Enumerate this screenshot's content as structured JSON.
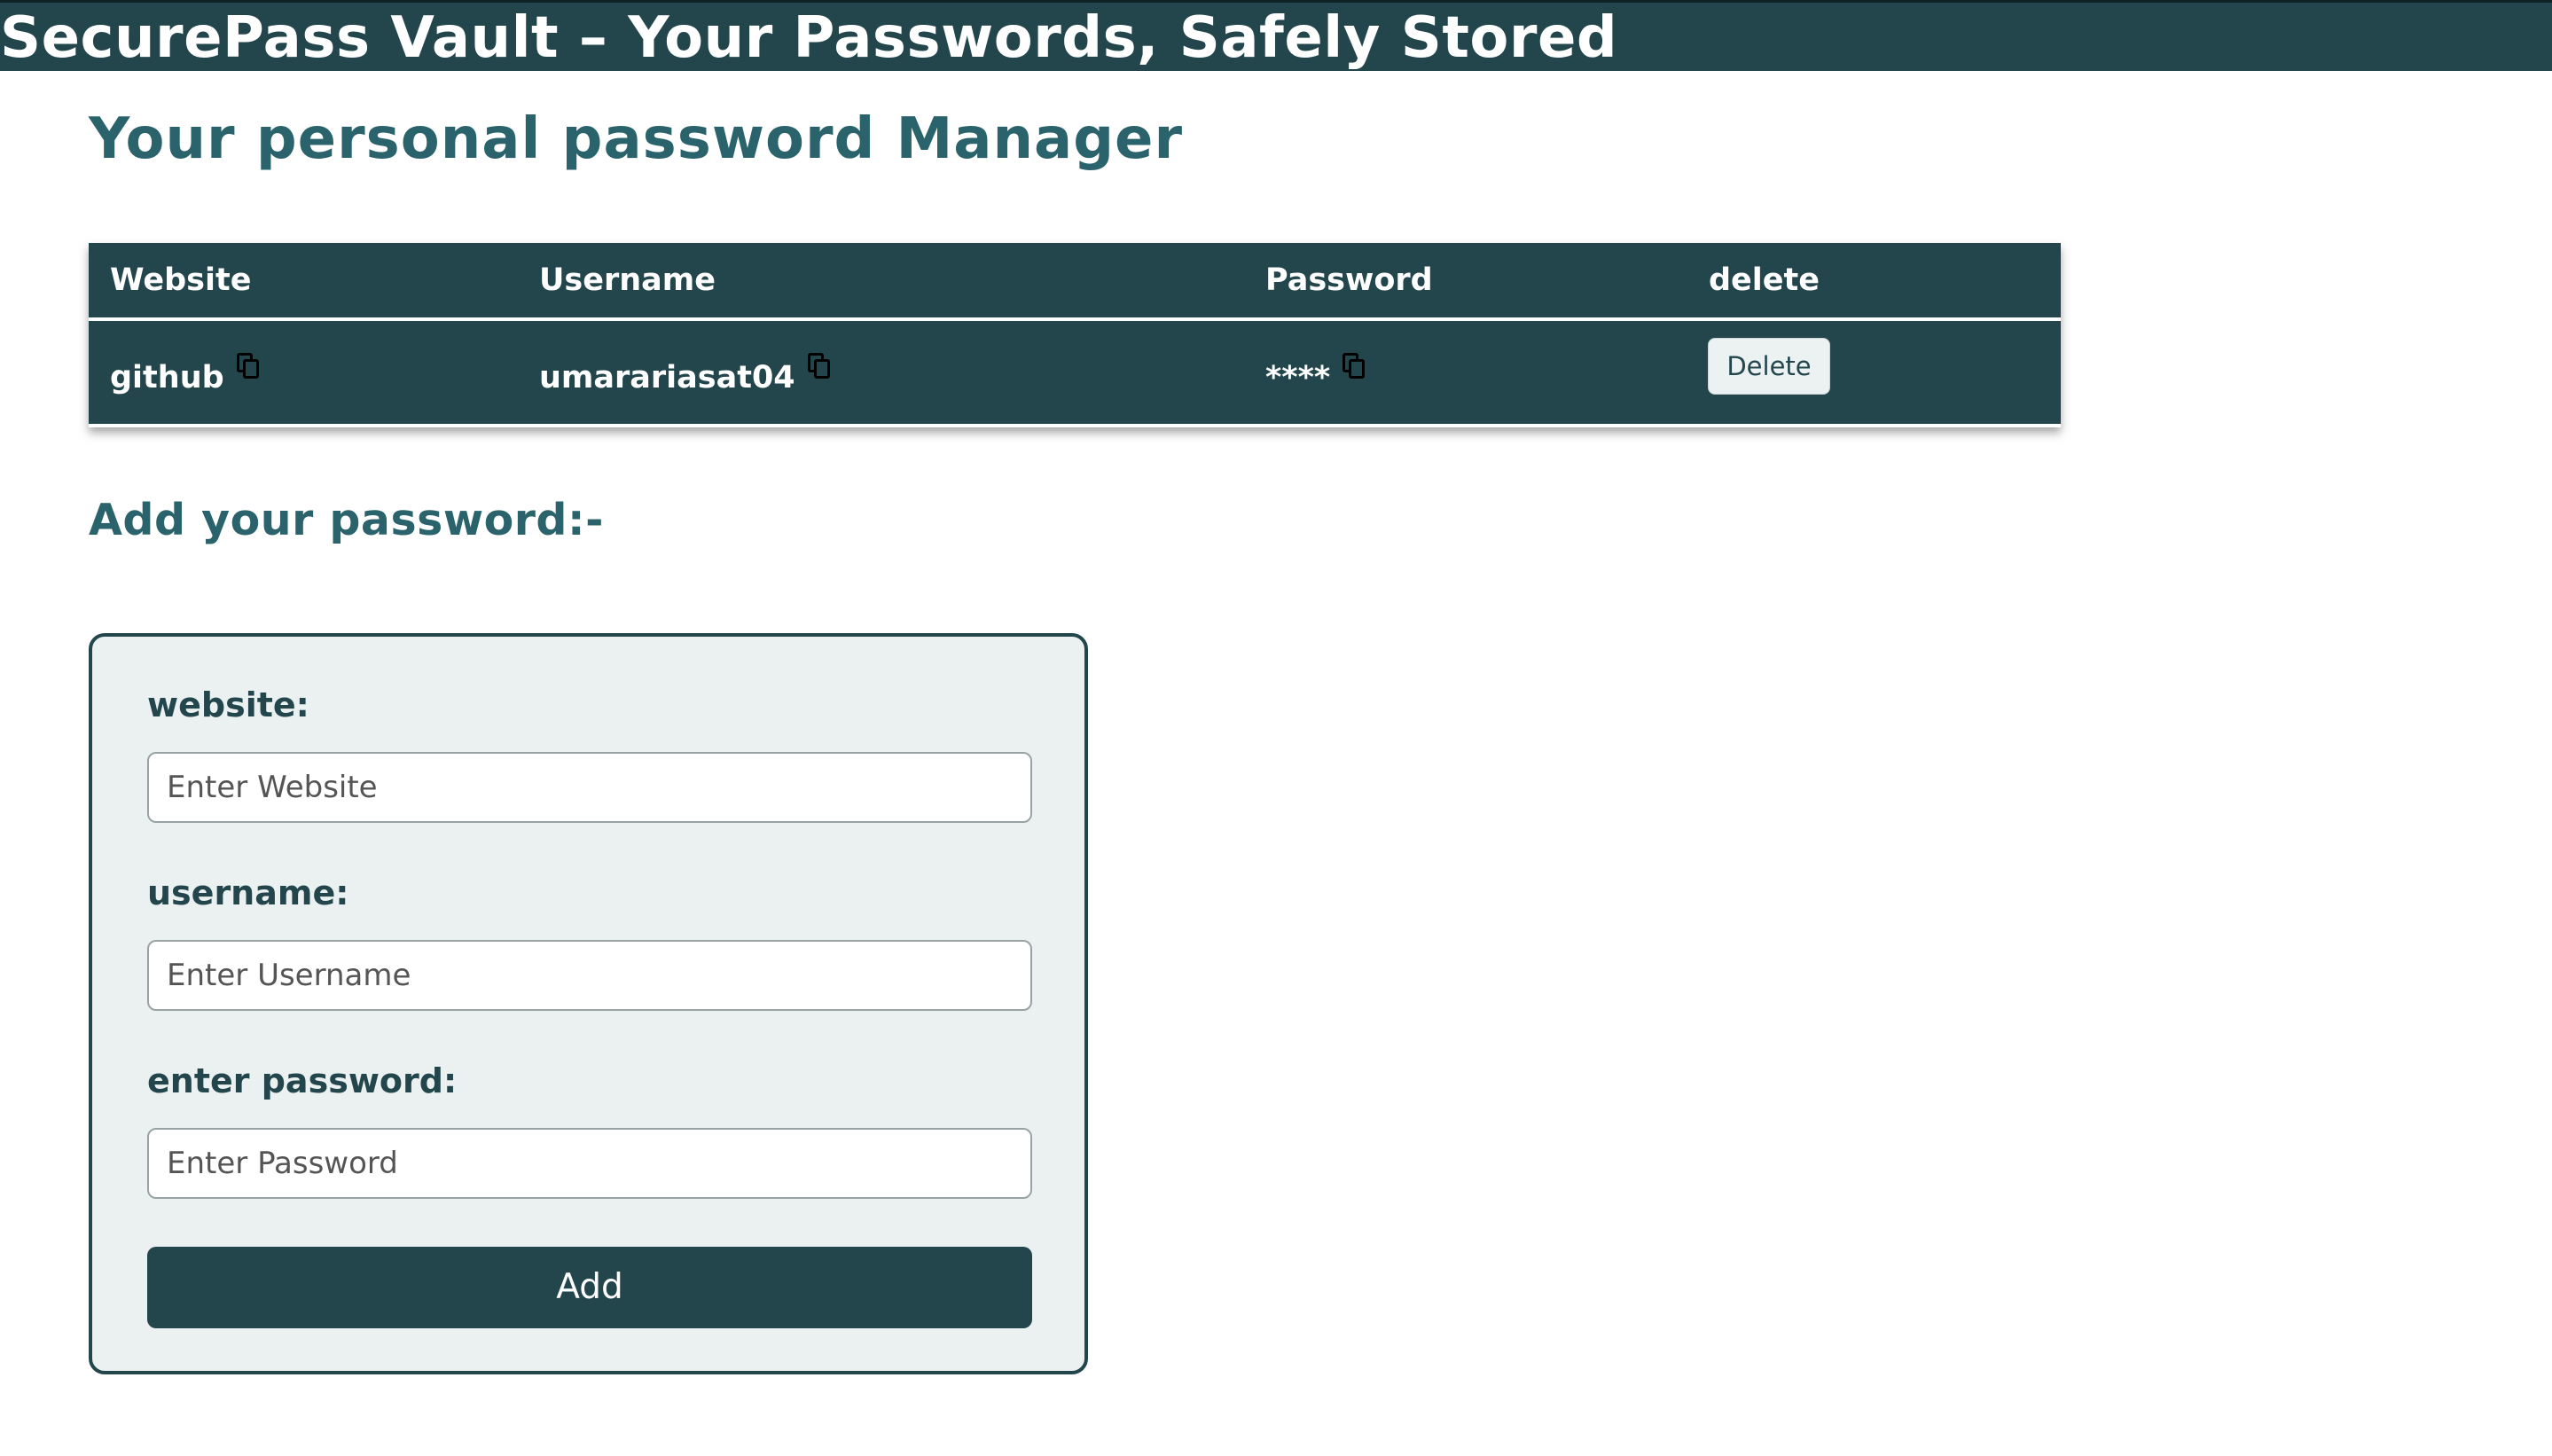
{
  "header": {
    "title": "SecurePass Vault – Your Passwords, Safely Stored"
  },
  "page": {
    "heading": "Your personal password Manager"
  },
  "table": {
    "columns": [
      "Website",
      "Username",
      "Password",
      "delete"
    ],
    "rows": [
      {
        "website": "github",
        "username": "umarariasat04",
        "password": "****",
        "delete_label": "Delete"
      }
    ]
  },
  "form": {
    "heading": "Add your password:-",
    "website_label": "website:",
    "website_placeholder": "Enter Website",
    "username_label": "username:",
    "username_placeholder": "Enter Username",
    "password_label": "enter password:",
    "password_placeholder": "Enter Password",
    "add_label": "Add"
  },
  "colors": {
    "primary": "#23464d",
    "heading": "#2a636b",
    "card_background": "#ebf0f0",
    "button_light": "#ecf1f1"
  },
  "icons": {
    "copy": "copy-icon"
  }
}
